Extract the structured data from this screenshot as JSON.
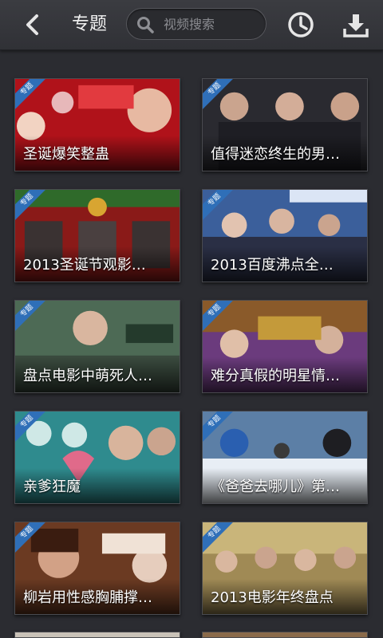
{
  "header": {
    "title": "专题",
    "search_placeholder": "视频搜索",
    "icons": {
      "back": "back-arrow-icon",
      "search": "search-icon",
      "history": "clock-icon",
      "download": "download-icon"
    }
  },
  "tag_label": "专题",
  "cards": [
    {
      "label": "圣诞爆笑整蛊",
      "theme": "#b0121a"
    },
    {
      "label": "值得迷恋终生的男…",
      "theme": "#2a2a30"
    },
    {
      "label": "2013圣诞节观影…",
      "theme": "#8a1a18"
    },
    {
      "label": "2013百度沸点全…",
      "theme": "#3b5f9b"
    },
    {
      "label": "盘点电影中萌死人…",
      "theme": "#4d6a55"
    },
    {
      "label": "难分真假的明星情…",
      "theme": "#6b3b7d"
    },
    {
      "label": "亲爹狂魔",
      "theme": "#2f8b8e"
    },
    {
      "label": "《爸爸去哪儿》第…",
      "theme": "#5c7fa6"
    },
    {
      "label": "柳岩用性感胸脯撑…",
      "theme": "#6b3a22"
    },
    {
      "label": "2013电影年终盘点",
      "theme": "#a08a55"
    }
  ]
}
